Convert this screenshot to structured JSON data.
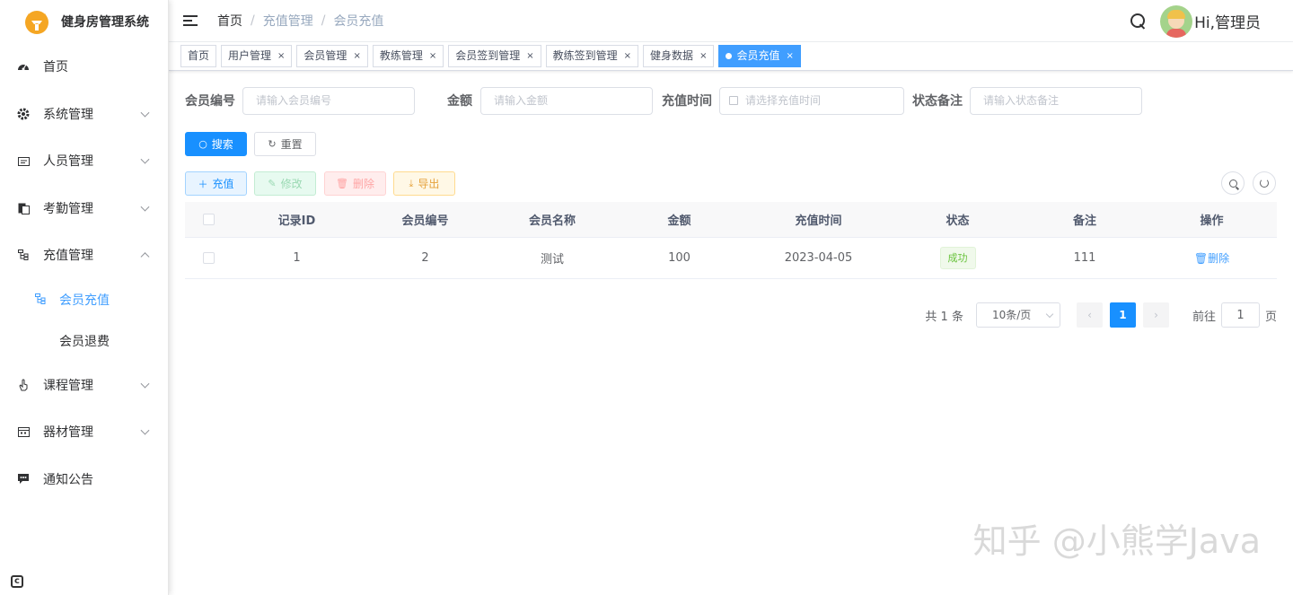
{
  "app": {
    "title": "健身房管理系统"
  },
  "sidebar": {
    "items": [
      {
        "label": "首页",
        "icon": "dashboard-icon"
      },
      {
        "label": "系统管理",
        "icon": "gear-icon"
      },
      {
        "label": "人员管理",
        "icon": "id-card-icon"
      },
      {
        "label": "考勤管理",
        "icon": "clipboard-icon"
      },
      {
        "label": "充值管理",
        "icon": "tree-icon"
      },
      {
        "label": "课程管理",
        "icon": "hand-pointer-icon"
      },
      {
        "label": "器材管理",
        "icon": "calendar-icon"
      },
      {
        "label": "通知公告",
        "icon": "message-icon"
      }
    ],
    "sub_items": [
      {
        "label": "会员充值",
        "active": true
      },
      {
        "label": "会员退费",
        "active": false
      }
    ]
  },
  "header": {
    "breadcrumb": [
      "首页",
      "充值管理",
      "会员充值"
    ],
    "greeting": "Hi,管理员"
  },
  "tags": [
    {
      "label": "首页"
    },
    {
      "label": "用户管理"
    },
    {
      "label": "会员管理"
    },
    {
      "label": "教练管理"
    },
    {
      "label": "会员签到管理"
    },
    {
      "label": "教练签到管理"
    },
    {
      "label": "健身数据"
    },
    {
      "label": "会员充值"
    }
  ],
  "filters": {
    "member_no": {
      "label": "会员编号",
      "placeholder": "请输入会员编号"
    },
    "amount": {
      "label": "金额",
      "placeholder": "请输入金额"
    },
    "recharge_time": {
      "label": "充值时间",
      "placeholder": "请选择充值时间"
    },
    "status_note": {
      "label": "状态备注",
      "placeholder": "请输入状态备注"
    },
    "search_label": "搜索",
    "reset_label": "重置"
  },
  "toolbar": {
    "add_label": "充值",
    "edit_label": "修改",
    "delete_label": "删除",
    "export_label": "导出"
  },
  "table": {
    "columns": [
      "记录ID",
      "会员编号",
      "会员名称",
      "金额",
      "充值时间",
      "状态",
      "备注",
      "操作"
    ],
    "rows": [
      {
        "id": "1",
        "member_no": "2",
        "member_name": "测试",
        "amount": "100",
        "time": "2023-04-05",
        "status": "成功",
        "note": "111",
        "action": "删除"
      }
    ]
  },
  "pagination": {
    "total": "共 1 条",
    "page_size": "10条/页",
    "current": "1",
    "goto_prefix": "前往",
    "goto_value": "1",
    "goto_suffix": "页"
  },
  "watermark": "知乎 @小熊学Java",
  "colors": {
    "primary": "#1890ff",
    "success": "#67c23a",
    "danger": "#f56c6c",
    "warning": "#e6a23c"
  }
}
